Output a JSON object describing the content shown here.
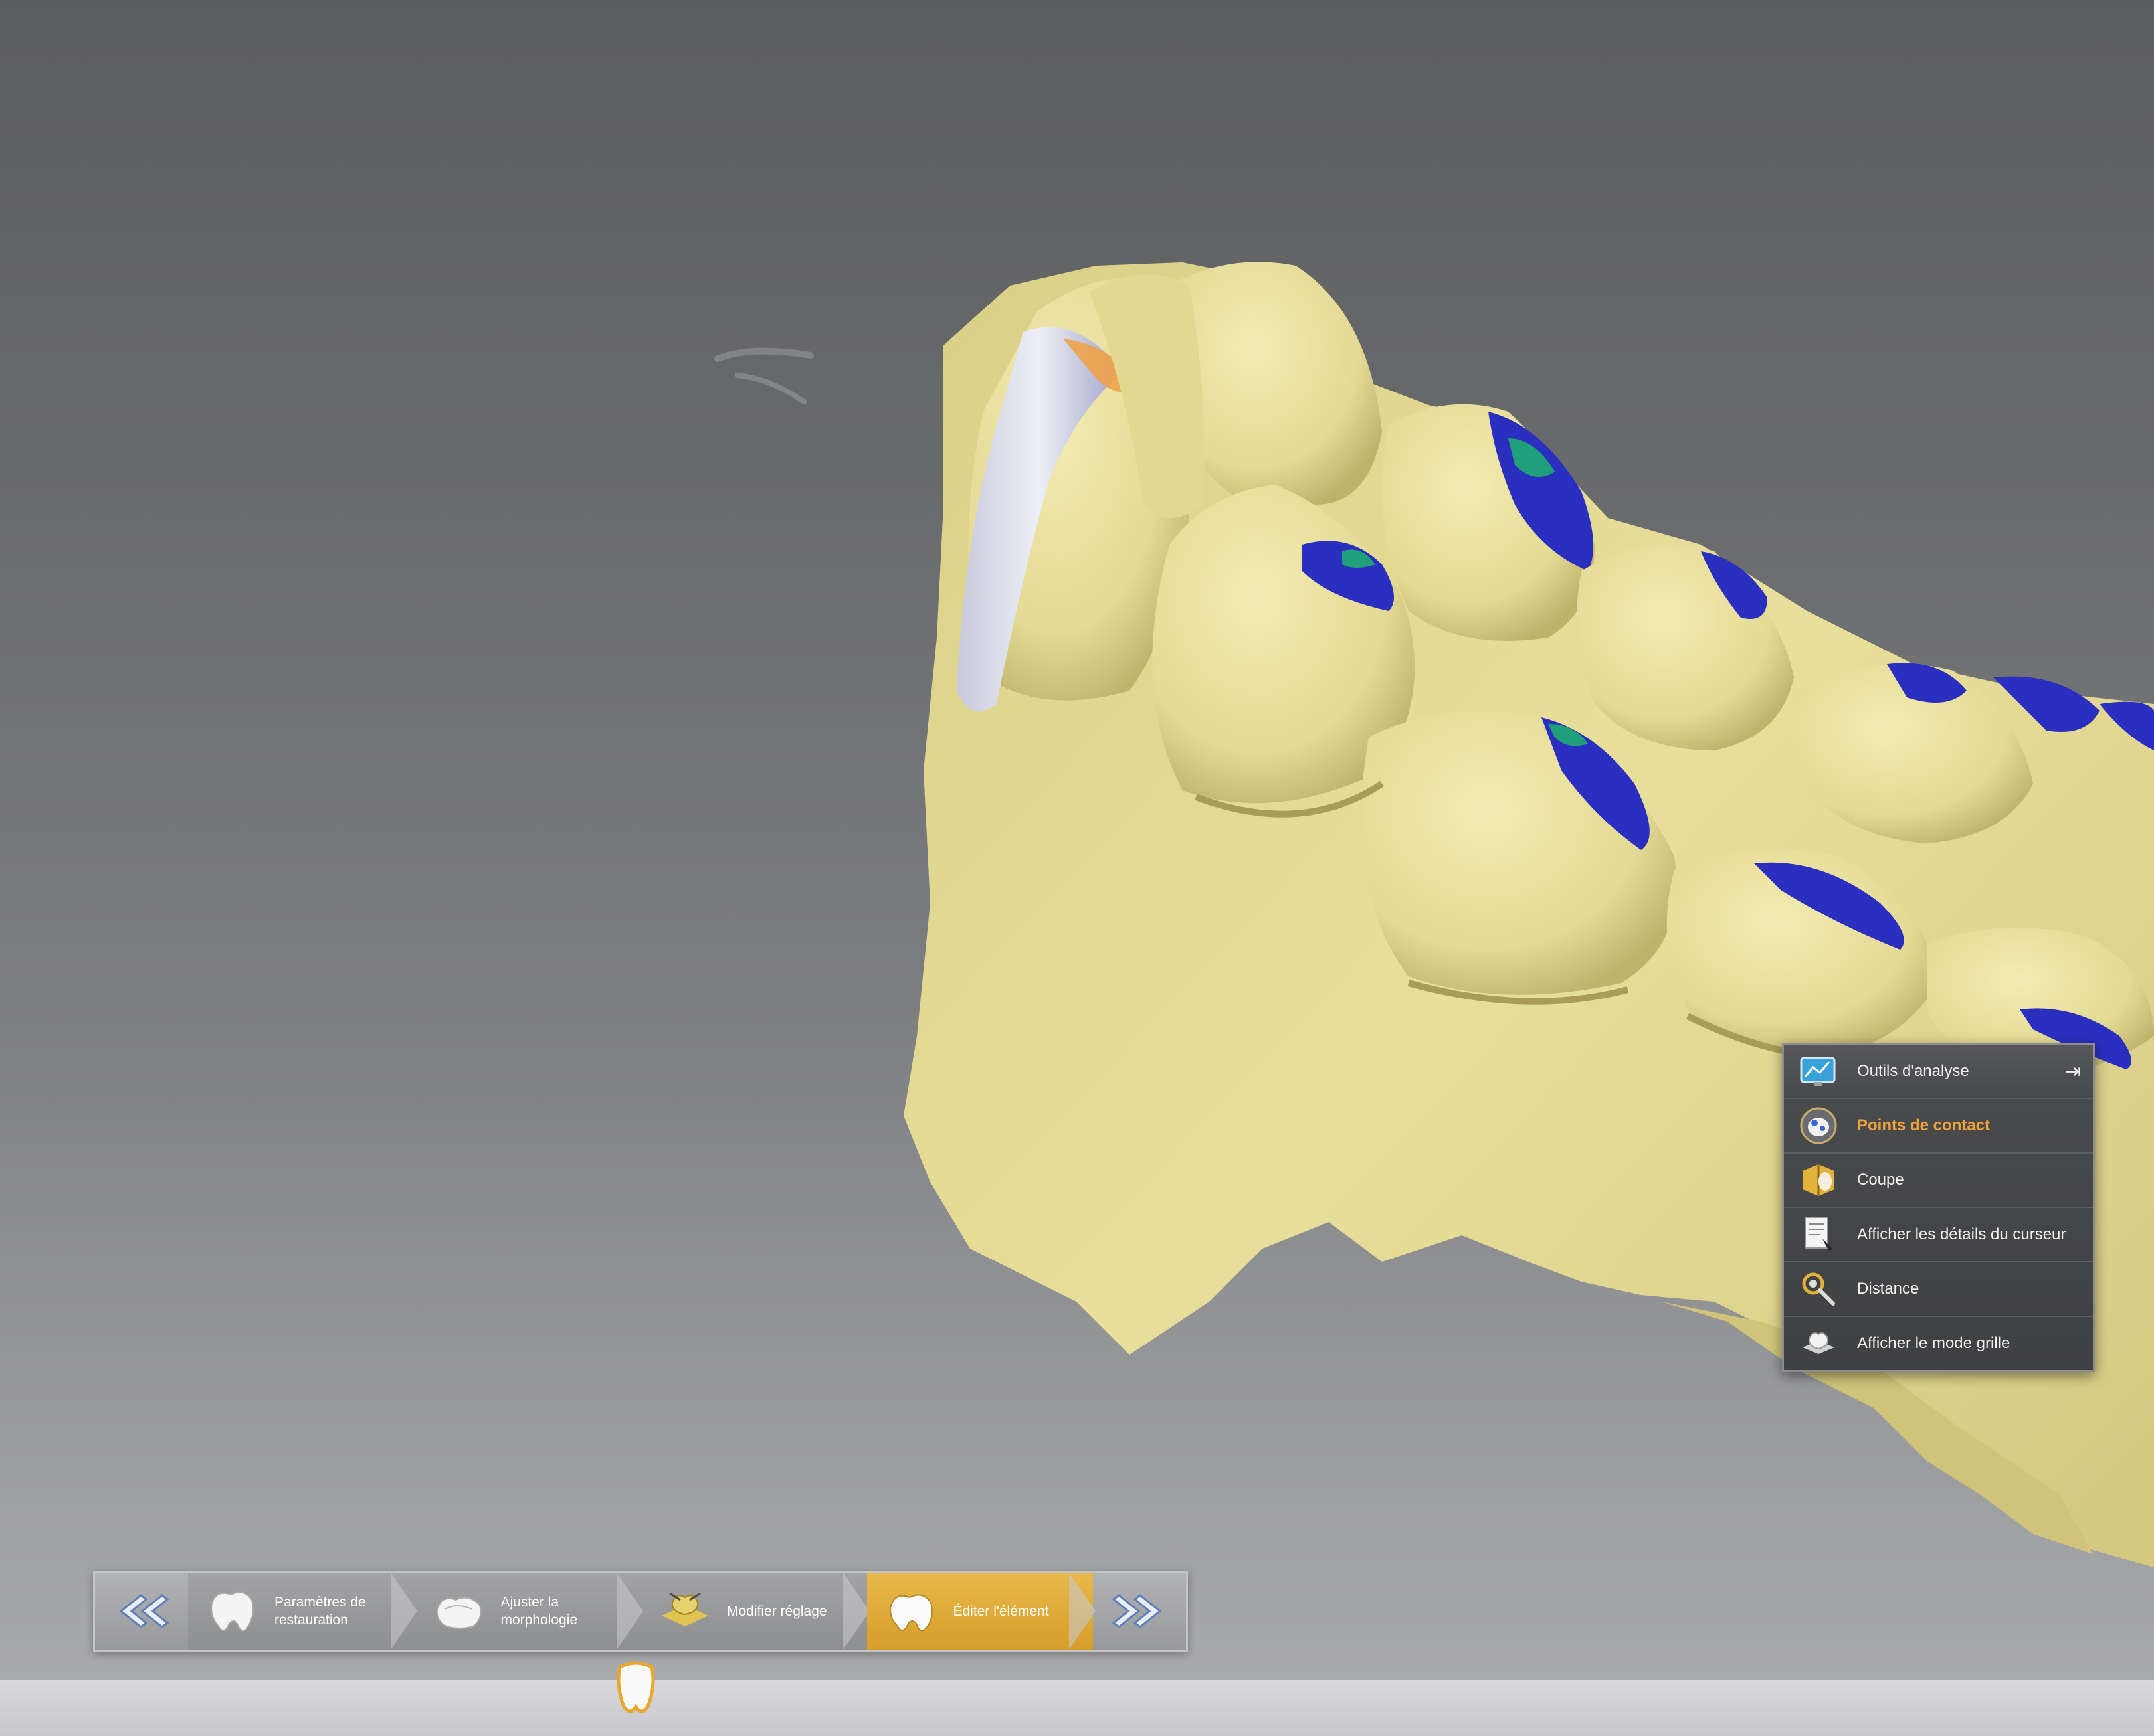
{
  "analysis_panel": {
    "header": {
      "label": "Outils d'analyse",
      "icon": "analysis-monitor-icon",
      "pin_icon": "pin-icon"
    },
    "items": [
      {
        "label": "Points de contact",
        "icon": "contact-points-icon",
        "active": true
      },
      {
        "label": "Coupe",
        "icon": "section-cut-icon",
        "active": false
      },
      {
        "label": "Afficher les détails du curseur",
        "icon": "cursor-details-icon",
        "active": false
      },
      {
        "label": "Distance",
        "icon": "distance-caliper-icon",
        "active": false
      },
      {
        "label": "Afficher le mode grille",
        "icon": "grid-mode-icon",
        "active": false
      }
    ]
  },
  "workflow": {
    "back_icon": "double-chevron-left-icon",
    "forward_icon": "double-chevron-right-icon",
    "steps": [
      {
        "label": "Paramètres de restauration",
        "icon": "tooth-parameters-icon",
        "active": false
      },
      {
        "label": "Ajuster la morphologie",
        "icon": "tooth-morphology-icon",
        "active": false
      },
      {
        "label": "Modifier réglage",
        "icon": "modify-settings-icon",
        "active": false
      },
      {
        "label": "Éditer l'élément",
        "icon": "edit-element-icon",
        "active": true
      }
    ]
  },
  "colors": {
    "model": "#e6dc95",
    "contact_blue": "#2a2fc0",
    "contact_green": "#1fa07a",
    "active_step": "#dca632",
    "active_tool_text": "#f3a23a"
  }
}
